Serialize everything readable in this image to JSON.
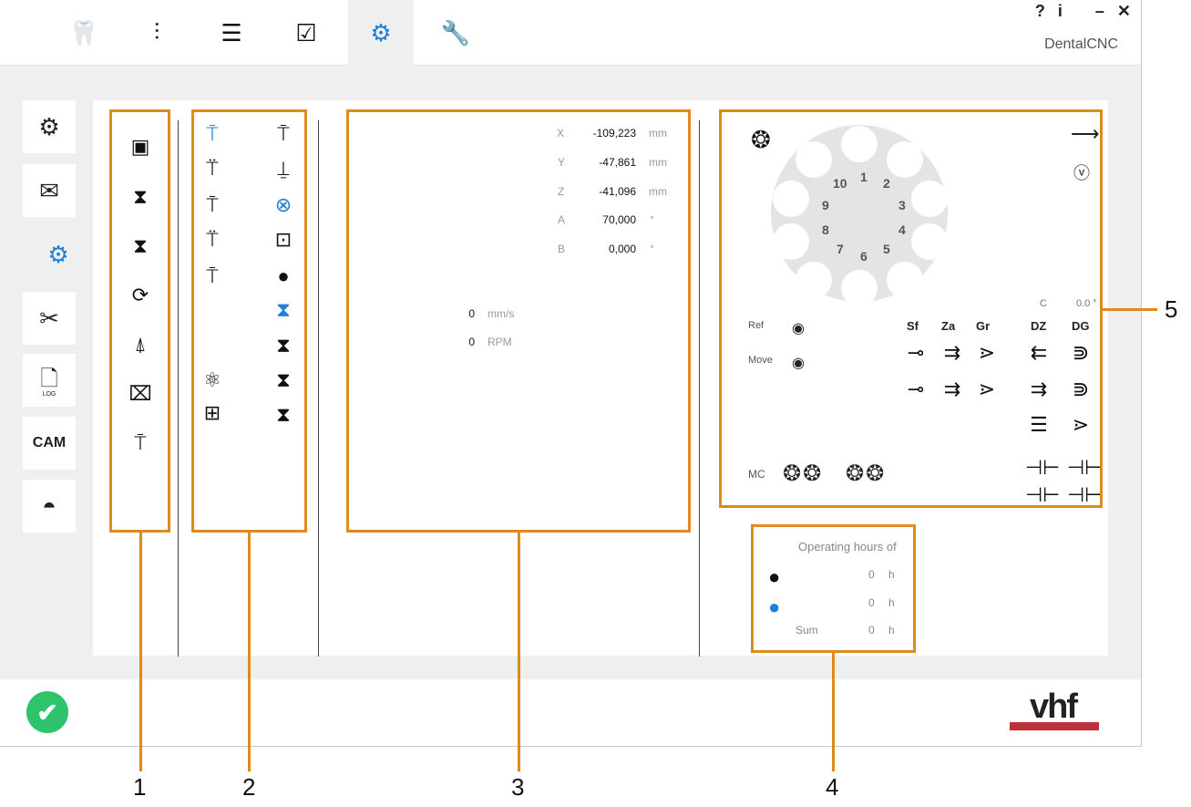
{
  "window": {
    "title": "DentalCNC",
    "controls": [
      "?",
      "i",
      "–",
      "✕"
    ]
  },
  "top_tabs": [
    {
      "name": "tab-tooth",
      "glyph": "🦷"
    },
    {
      "name": "tab-adjust",
      "glyph": "⫶"
    },
    {
      "name": "tab-list",
      "glyph": "☰"
    },
    {
      "name": "tab-checklist",
      "glyph": "☑"
    },
    {
      "name": "tab-settings",
      "glyph": "⚙"
    },
    {
      "name": "tab-tools",
      "glyph": "🔧"
    }
  ],
  "sidebar": {
    "items": [
      {
        "glyph": "⚙"
      },
      {
        "glyph": "✉"
      },
      {
        "glyph": "⚙"
      },
      {
        "glyph": "✂"
      },
      {
        "glyph": "🗋",
        "label": "LOG"
      },
      {
        "label": "CAM"
      },
      {
        "glyph": "◓"
      }
    ]
  },
  "axes": [
    {
      "axis": "X",
      "value": "-109,223",
      "unit": "mm"
    },
    {
      "axis": "Y",
      "value": "-47,861",
      "unit": "mm"
    },
    {
      "axis": "Z",
      "value": "-41,096",
      "unit": "mm"
    },
    {
      "axis": "A",
      "value": "70,000",
      "unit": "°"
    },
    {
      "axis": "B",
      "value": "0,000",
      "unit": "°"
    }
  ],
  "speed": [
    {
      "value": "0",
      "unit": "mm/s"
    },
    {
      "value": "0",
      "unit": "RPM"
    }
  ],
  "magazine": {
    "positions": [
      "1",
      "2",
      "3",
      "4",
      "5",
      "6",
      "7",
      "8",
      "9",
      "10"
    ],
    "c_label": "C",
    "c_value": "0.0 °",
    "ref_label": "Ref",
    "move_label": "Move",
    "col_headers": [
      "Sf",
      "Za",
      "Gr",
      "DZ",
      "DG"
    ],
    "mc_label": "MC"
  },
  "hours": {
    "title": "Operating hours of",
    "rows": [
      {
        "label": "",
        "value": "0",
        "unit": "h"
      },
      {
        "label": "",
        "value": "0",
        "unit": "h"
      },
      {
        "label": "Sum",
        "value": "0",
        "unit": "h"
      }
    ]
  },
  "callouts": [
    "1",
    "2",
    "3",
    "4",
    "5"
  ],
  "logo": "vhf",
  "colors": {
    "accent": "#1e7fd6",
    "highlight": "#e08a1e",
    "ok": "#2ec46b",
    "brand": "#c0303a"
  }
}
